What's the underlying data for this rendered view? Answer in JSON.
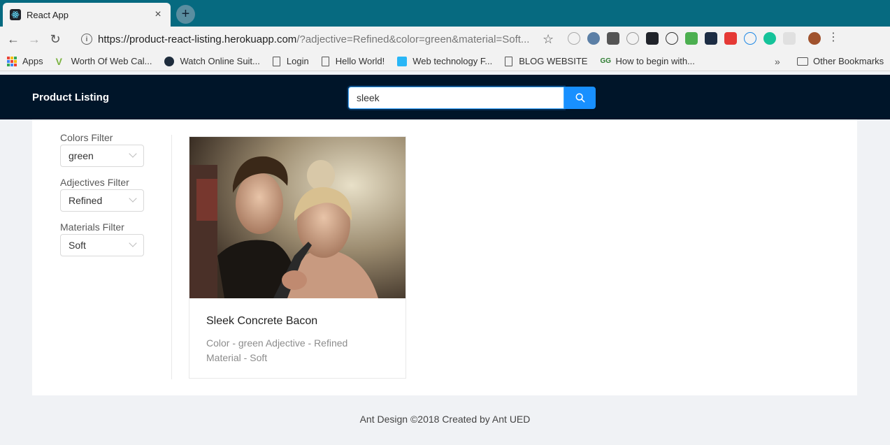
{
  "browser": {
    "tab_title": "React App",
    "url_host": "https://product-react-listing.herokuapp.com",
    "url_rest": "/?adjective=Refined&color=green&material=Soft...",
    "bookmarks": [
      "Apps",
      "Worth Of Web Cal...",
      "Watch Online Suit...",
      "Login",
      "Hello World!",
      "Web technology F...",
      "BLOG WEBSITE",
      "How to begin with..."
    ],
    "other_bookmarks": "Other Bookmarks"
  },
  "header": {
    "brand": "Product Listing",
    "search_value": "sleek"
  },
  "filters": {
    "colors_label": "Colors Filter",
    "colors_value": "green",
    "adjectives_label": "Adjectives Filter",
    "adjectives_value": "Refined",
    "materials_label": "Materials Filter",
    "materials_value": "Soft"
  },
  "product": {
    "title": "Sleek Concrete Bacon",
    "desc_line1": "Color - green Adjective - Refined",
    "desc_line2": "Material - Soft"
  },
  "footer": {
    "text": "Ant Design ©2018 Created by Ant UED"
  }
}
